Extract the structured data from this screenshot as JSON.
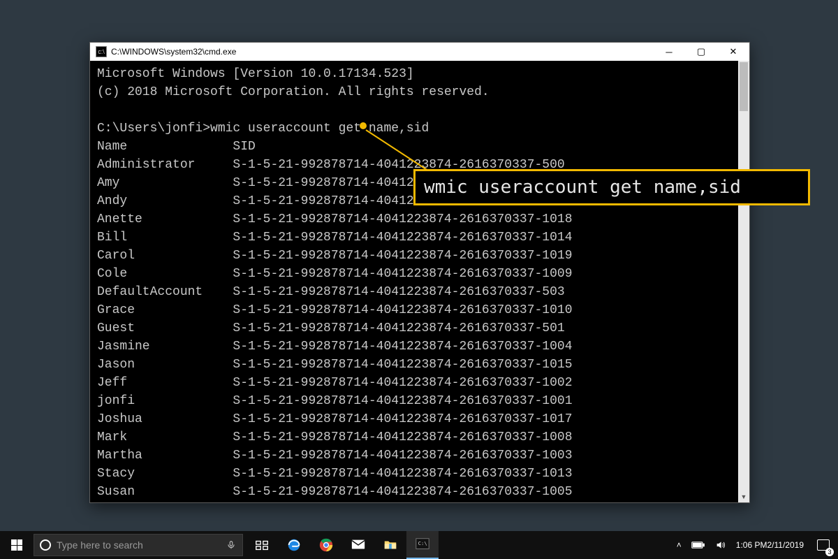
{
  "window": {
    "title": "C:\\WINDOWS\\system32\\cmd.exe"
  },
  "terminal": {
    "banner1": "Microsoft Windows [Version 10.0.17134.523]",
    "banner2": "(c) 2018 Microsoft Corporation. All rights reserved.",
    "prompt": "C:\\Users\\jonfi>",
    "command": "wmic useraccount get name,sid",
    "header_name": "Name",
    "header_sid": "SID",
    "rows": [
      {
        "name": "Administrator",
        "sid": "S-1-5-21-992878714-4041223874-2616370337-500"
      },
      {
        "name": "Amy",
        "sid": "S-1-5-21-992878714-4041223874-2616370337-1016"
      },
      {
        "name": "Andy",
        "sid": "S-1-5-21-992878714-4041223874-2616370337-1006"
      },
      {
        "name": "Anette",
        "sid": "S-1-5-21-992878714-4041223874-2616370337-1018"
      },
      {
        "name": "Bill",
        "sid": "S-1-5-21-992878714-4041223874-2616370337-1014"
      },
      {
        "name": "Carol",
        "sid": "S-1-5-21-992878714-4041223874-2616370337-1019"
      },
      {
        "name": "Cole",
        "sid": "S-1-5-21-992878714-4041223874-2616370337-1009"
      },
      {
        "name": "DefaultAccount",
        "sid": "S-1-5-21-992878714-4041223874-2616370337-503"
      },
      {
        "name": "Grace",
        "sid": "S-1-5-21-992878714-4041223874-2616370337-1010"
      },
      {
        "name": "Guest",
        "sid": "S-1-5-21-992878714-4041223874-2616370337-501"
      },
      {
        "name": "Jasmine",
        "sid": "S-1-5-21-992878714-4041223874-2616370337-1004"
      },
      {
        "name": "Jason",
        "sid": "S-1-5-21-992878714-4041223874-2616370337-1015"
      },
      {
        "name": "Jeff",
        "sid": "S-1-5-21-992878714-4041223874-2616370337-1002"
      },
      {
        "name": "jonfi",
        "sid": "S-1-5-21-992878714-4041223874-2616370337-1001"
      },
      {
        "name": "Joshua",
        "sid": "S-1-5-21-992878714-4041223874-2616370337-1017"
      },
      {
        "name": "Mark",
        "sid": "S-1-5-21-992878714-4041223874-2616370337-1008"
      },
      {
        "name": "Martha",
        "sid": "S-1-5-21-992878714-4041223874-2616370337-1003"
      },
      {
        "name": "Stacy",
        "sid": "S-1-5-21-992878714-4041223874-2616370337-1013"
      },
      {
        "name": "Susan",
        "sid": "S-1-5-21-992878714-4041223874-2616370337-1005"
      }
    ]
  },
  "callout": {
    "text": "wmic useraccount get name,sid"
  },
  "taskbar": {
    "search_placeholder": "Type here to search",
    "clock_time": "1:06 PM",
    "clock_date": "2/11/2019",
    "notif_count": "3"
  }
}
